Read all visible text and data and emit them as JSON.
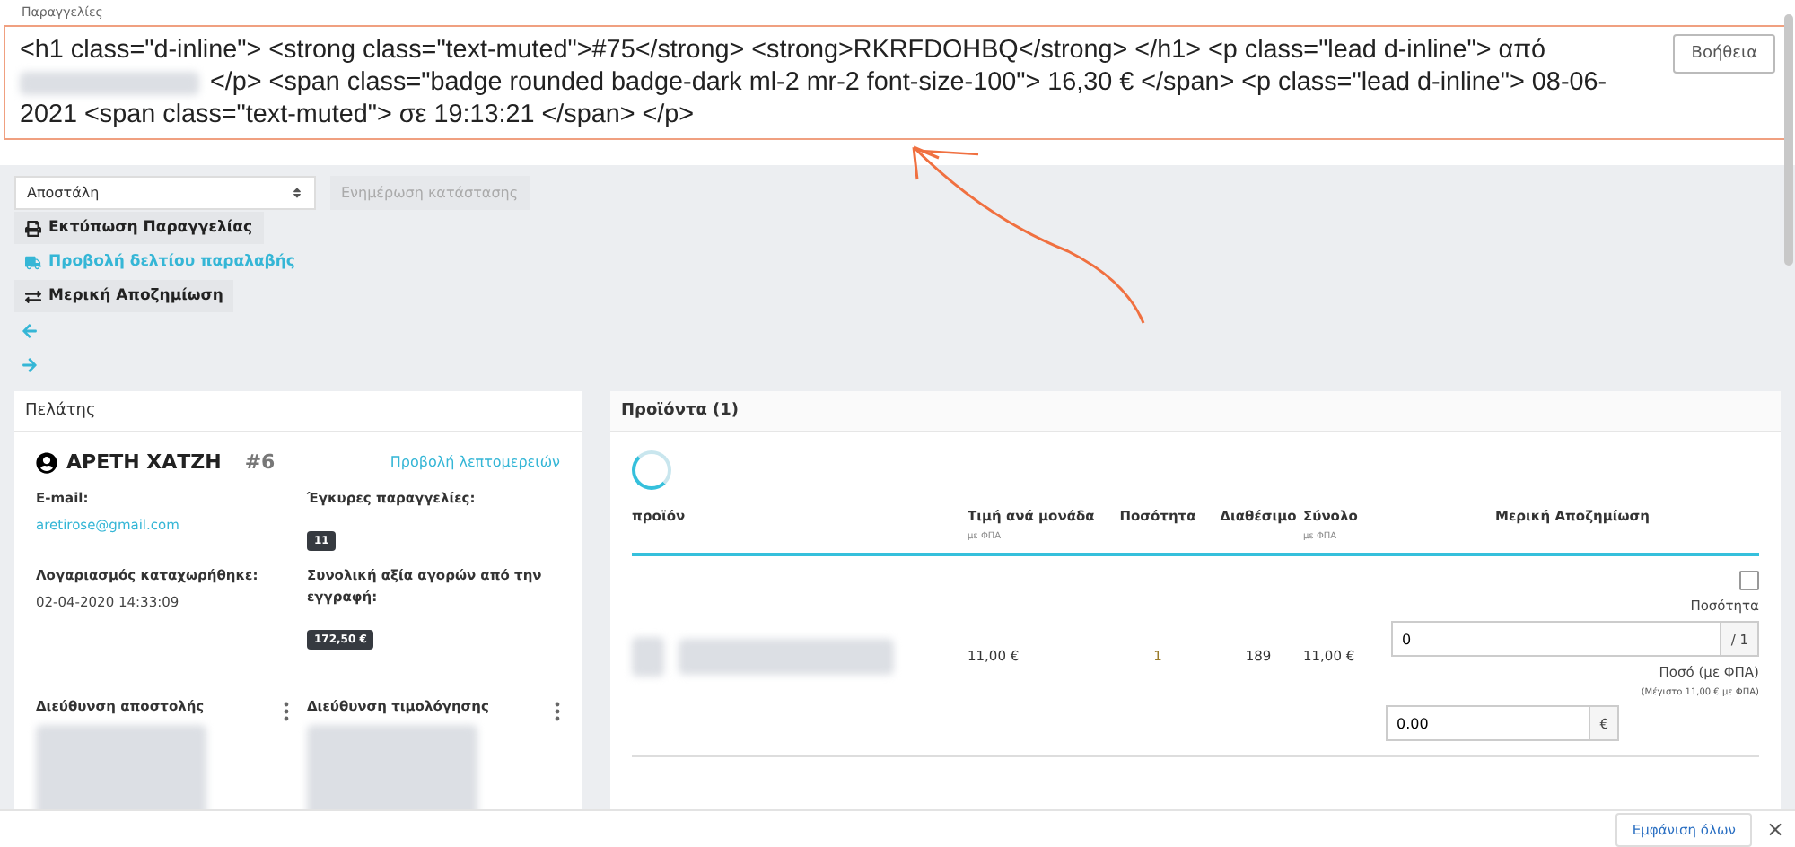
{
  "breadcrumb": "Παραγγελίες",
  "header": {
    "lines": [
      "<h1 class=\"d-inline\"> <strong class=\"text-muted\">#75</strong> <strong>RKRFDOHBQ</strong> </h1> <p class=\"lead d-inline\"> από",
      "</p> <span class=\"badge rounded badge-dark ml-2 mr-2 font-size-100\"> 16,30 € </span> <p class=\"lead d-inline\"> 08-06-",
      "2021 <span class=\"text-muted\"> σε 19:13:21 </span> </p>"
    ],
    "help_button": "Βοήθεια"
  },
  "status_select": {
    "value": "Αποστάλη"
  },
  "update_button": {
    "label": "Ενημέρωση κατάστασης",
    "disabled": true
  },
  "actions": [
    {
      "kind": "print",
      "label": "Εκτύπωση Παραγγελίας"
    },
    {
      "kind": "truck",
      "label": "Προβολή δελτίου παραλαβής"
    },
    {
      "kind": "exchange",
      "label": "Μερική Αποζημίωση"
    },
    {
      "kind": "back"
    },
    {
      "kind": "forward"
    }
  ],
  "customer": {
    "title": "Πελάτης",
    "name": "ΑΡΕΤΗ ΧΑΤΖΗ",
    "id": "#6",
    "details_link": "Προβολή λεπτομερειών",
    "fields": [
      {
        "label": "E-mail:",
        "kind": "link",
        "value": "aretirose@gmail.com"
      },
      {
        "label": "Έγκυρες παραγγελίες:",
        "kind": "badge",
        "value": "11"
      },
      {
        "label": "Λογαριασμός καταχωρήθηκε:",
        "kind": "text",
        "value": "02-04-2020 14:33:09"
      },
      {
        "label": "Συνολική αξία αγορών από την εγγραφή:",
        "kind": "badge",
        "value": "172,50 €"
      }
    ],
    "addresses": [
      {
        "title": "Διεύθυνση αποστολής"
      },
      {
        "title": "Διεύθυνση τιμολόγησης"
      }
    ]
  },
  "products": {
    "title": "Προϊόντα (1)",
    "columns": [
      {
        "label": "προϊόν"
      },
      {
        "label": "Τιμή ανά μονάδα",
        "sub": "με ΦΠΑ"
      },
      {
        "label": "Ποσότητα"
      },
      {
        "label": "Διαθέσιμο"
      },
      {
        "label": "Σύνολο",
        "sub": "με ΦΠΑ"
      },
      {
        "label": "Μερική Αποζημίωση"
      }
    ],
    "rows": [
      {
        "price": "11,00 €",
        "quantity": "1",
        "available": "189",
        "total": "11,00 €",
        "refund": {
          "checked": false,
          "quantity_label": "Ποσότητα",
          "quantity_value": "0",
          "quantity_suffix": "/ 1",
          "amount_label": "Ποσό (με ΦΠΑ)",
          "amount_hint": "(Μέγιστο 11,00 € με ΦΠΑ)",
          "amount_value": "0.00",
          "amount_suffix": "€"
        }
      }
    ]
  },
  "bottom_bar": {
    "show_all_button": "Εμφάνιση όλων",
    "close": "×"
  }
}
